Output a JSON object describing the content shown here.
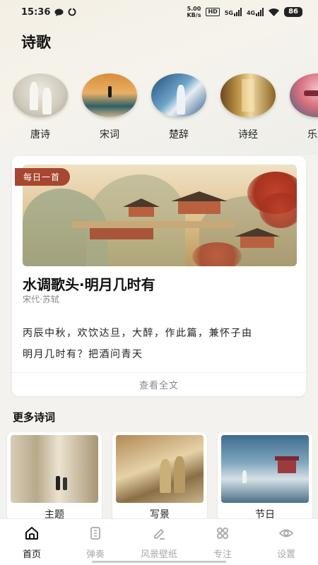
{
  "status_bar": {
    "time": "15:36",
    "net_speed_value": "5.00",
    "net_speed_unit": "KB/s",
    "hd_label": "HD",
    "signal_1": "5G",
    "signal_2": "4G",
    "battery": "86"
  },
  "header": {
    "title": "诗歌"
  },
  "categories": [
    {
      "label": "唐诗",
      "icon": "tang-poetry-thumbnail"
    },
    {
      "label": "宋词",
      "icon": "song-ci-thumbnail"
    },
    {
      "label": "楚辞",
      "icon": "chuci-thumbnail"
    },
    {
      "label": "诗经",
      "icon": "shijing-thumbnail"
    },
    {
      "label": "乐府",
      "icon": "yuefu-thumbnail"
    }
  ],
  "daily_poem": {
    "badge": "每日一首",
    "title": "水调歌头·明月几时有",
    "author": "宋代·苏轼",
    "lines": [
      "丙辰中秋，欢饮达旦，大醉，作此篇，兼怀子由",
      "明月几时有？把酒问青天"
    ],
    "read_more": "查看全文"
  },
  "more_section": {
    "title": "更多诗词",
    "items": [
      {
        "label": "主题"
      },
      {
        "label": "写景"
      },
      {
        "label": "节日"
      }
    ]
  },
  "tab_bar": {
    "tabs": [
      {
        "label": "首页",
        "icon": "home-icon",
        "active": true
      },
      {
        "label": "弹奏",
        "icon": "instrument-icon",
        "active": false
      },
      {
        "label": "风景壁纸",
        "icon": "wallpaper-edit-icon",
        "active": false
      },
      {
        "label": "专注",
        "icon": "grid-icon",
        "active": false
      },
      {
        "label": "设置",
        "icon": "eye-settings-icon",
        "active": false
      }
    ]
  },
  "colors": {
    "accent_badge": "#a8472f",
    "active_tab": "#111111",
    "inactive_tab": "#aaaaaa"
  }
}
